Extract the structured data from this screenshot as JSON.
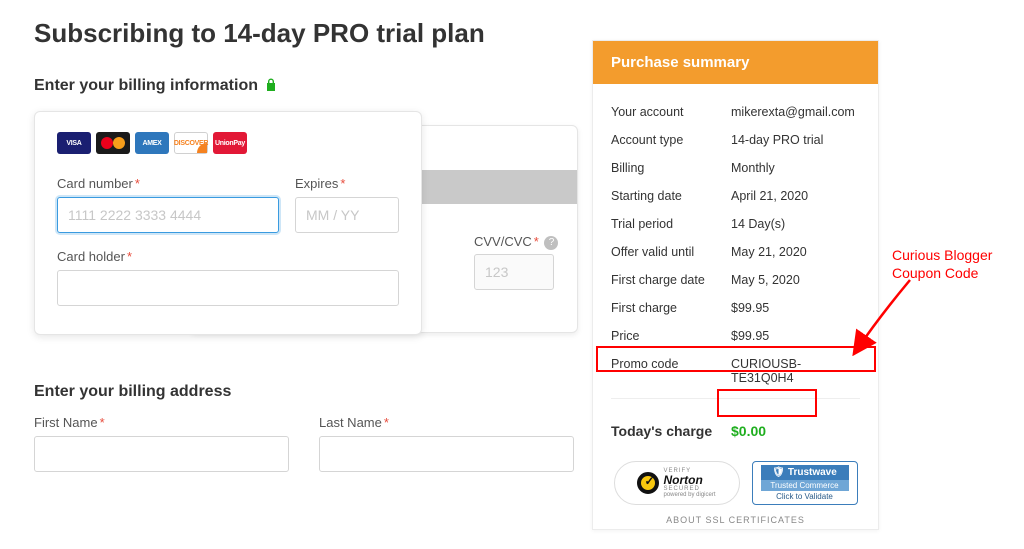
{
  "title": "Subscribing to 14-day PRO trial plan",
  "billing_heading": "Enter your billing information",
  "address_heading": "Enter your billing address",
  "card": {
    "number_label": "Card number",
    "number_placeholder": "1111 2222 3333 4444",
    "expires_label": "Expires",
    "expires_placeholder": "MM / YY",
    "holder_label": "Card holder",
    "cvv_label": "CVV/CVC",
    "cvv_placeholder": "123"
  },
  "brands": {
    "visa": "VISA",
    "amex": "AMEX",
    "discover": "DISCOVER",
    "unionpay": "UnionPay"
  },
  "address": {
    "first_name_label": "First Name",
    "last_name_label": "Last Name"
  },
  "summary": {
    "header": "Purchase summary",
    "rows": [
      {
        "k": "Your account",
        "v": "mikerexta@gmail.com"
      },
      {
        "k": "Account type",
        "v": "14-day PRO trial"
      },
      {
        "k": "Billing",
        "v": "Monthly"
      },
      {
        "k": "Starting date",
        "v": "April 21, 2020"
      },
      {
        "k": "Trial period",
        "v": "14 Day(s)"
      },
      {
        "k": "Offer valid until",
        "v": "May 21, 2020"
      },
      {
        "k": "First charge date",
        "v": "May 5, 2020"
      },
      {
        "k": "First charge",
        "v": "$99.95"
      },
      {
        "k": "Price",
        "v": "$99.95"
      },
      {
        "k": "Promo code",
        "v": "CURIOUSB-TE31Q0H4"
      }
    ],
    "today_label": "Today's charge",
    "today_value": "$0.00",
    "about_ssl": "ABOUT SSL CERTIFICATES"
  },
  "trust": {
    "norton_verify": "VERIFY",
    "norton_name": "Norton",
    "norton_secured": "SECURED",
    "norton_powered": "powered by digicert",
    "trustwave_name": "Trustwave",
    "trustwave_mid": "Trusted Commerce",
    "trustwave_bot": "Click to Validate"
  },
  "annotation": {
    "line1": "Curious Blogger",
    "line2": "Coupon Code"
  }
}
